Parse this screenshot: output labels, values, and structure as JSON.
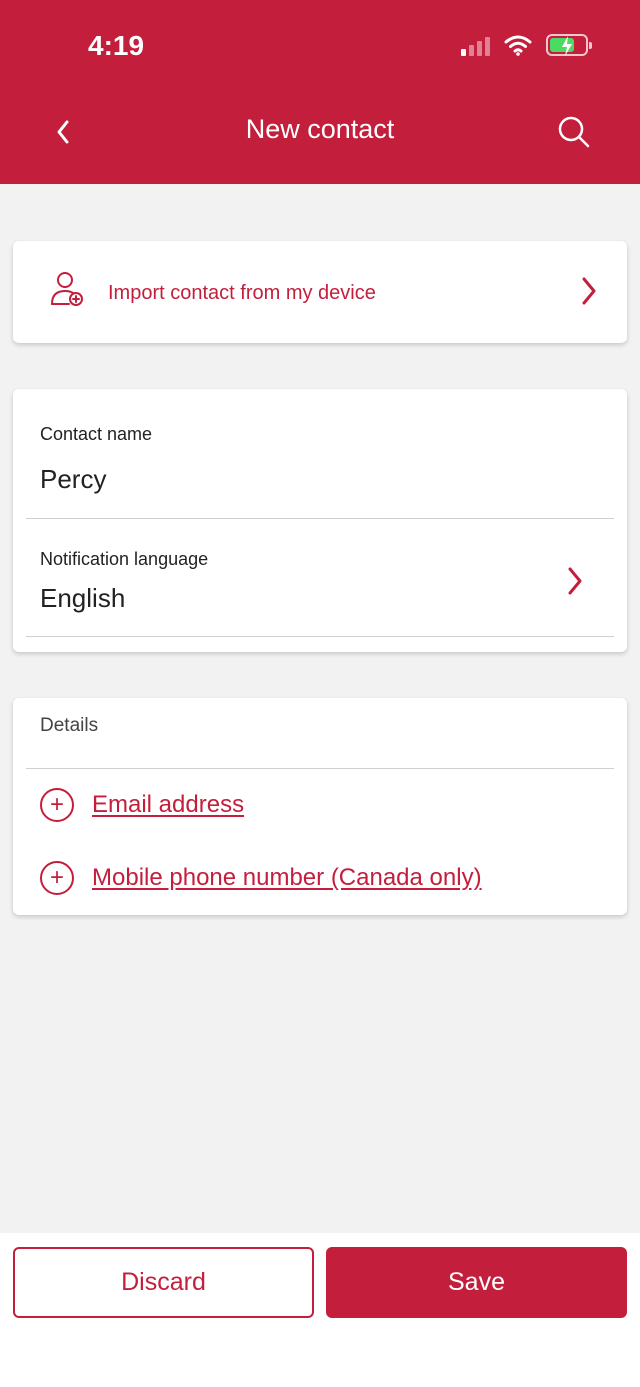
{
  "status_bar": {
    "time": "4:19",
    "signal_icon": "cellular-signal-icon",
    "wifi_icon": "wifi-icon",
    "battery_icon": "battery-charging-icon"
  },
  "header": {
    "title": "New contact",
    "back_icon": "chevron-left-icon",
    "search_icon": "search-icon"
  },
  "import": {
    "label": "Import contact from my device",
    "icon": "add-person-icon"
  },
  "form": {
    "name_label": "Contact name",
    "name_value": "Percy",
    "language_label": "Notification language",
    "language_value": "English"
  },
  "details": {
    "title": "Details",
    "add_email_label": "Email address",
    "add_phone_label": "Mobile phone number (Canada only)"
  },
  "footer": {
    "discard_label": "Discard",
    "save_label": "Save"
  },
  "colors": {
    "brand": "#c41e3d",
    "background": "#f2f2f2"
  }
}
